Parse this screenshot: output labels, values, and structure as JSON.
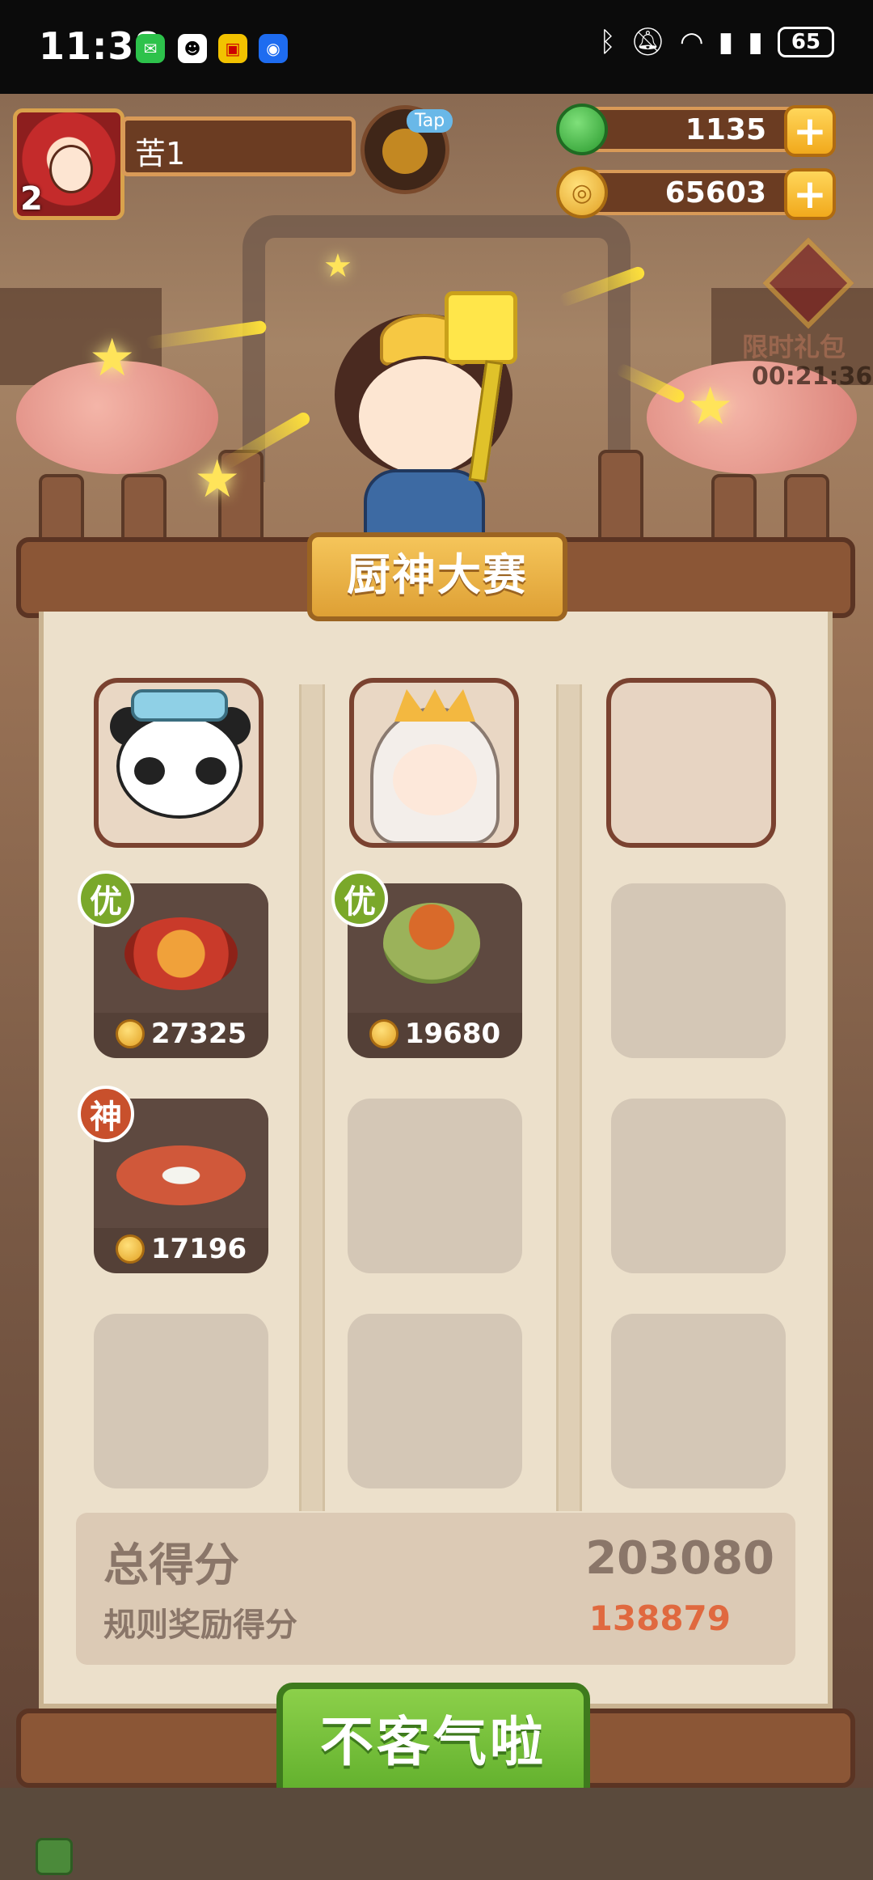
{
  "status_bar": {
    "time": "11:38",
    "battery": "65",
    "notifications": [
      "wechat-icon",
      "qq-icon",
      "app-icon",
      "bulb-icon"
    ]
  },
  "player": {
    "name": "苦1",
    "level": "2",
    "tap_label": "Tap"
  },
  "resources": {
    "gems": "1135",
    "coins": "65603"
  },
  "gift": {
    "label": "限时礼包",
    "timer": "00:21:36"
  },
  "contest": {
    "title": "厨神大赛",
    "dishes": [
      {
        "badge": "优",
        "price": "27325"
      },
      {
        "badge": "优",
        "price": "19680"
      },
      {
        "badge": "神",
        "price": "17196"
      }
    ]
  },
  "score": {
    "total_label": "总得分",
    "total_value": "203080",
    "bonus_label": "规则奖励得分",
    "bonus_value": "138879"
  },
  "confirm_button": "不客气啦",
  "colors": {
    "panel": "#ece0cb",
    "wood": "#8b5636",
    "accent_green": "#6db435",
    "bonus_orange": "#e0693f"
  }
}
